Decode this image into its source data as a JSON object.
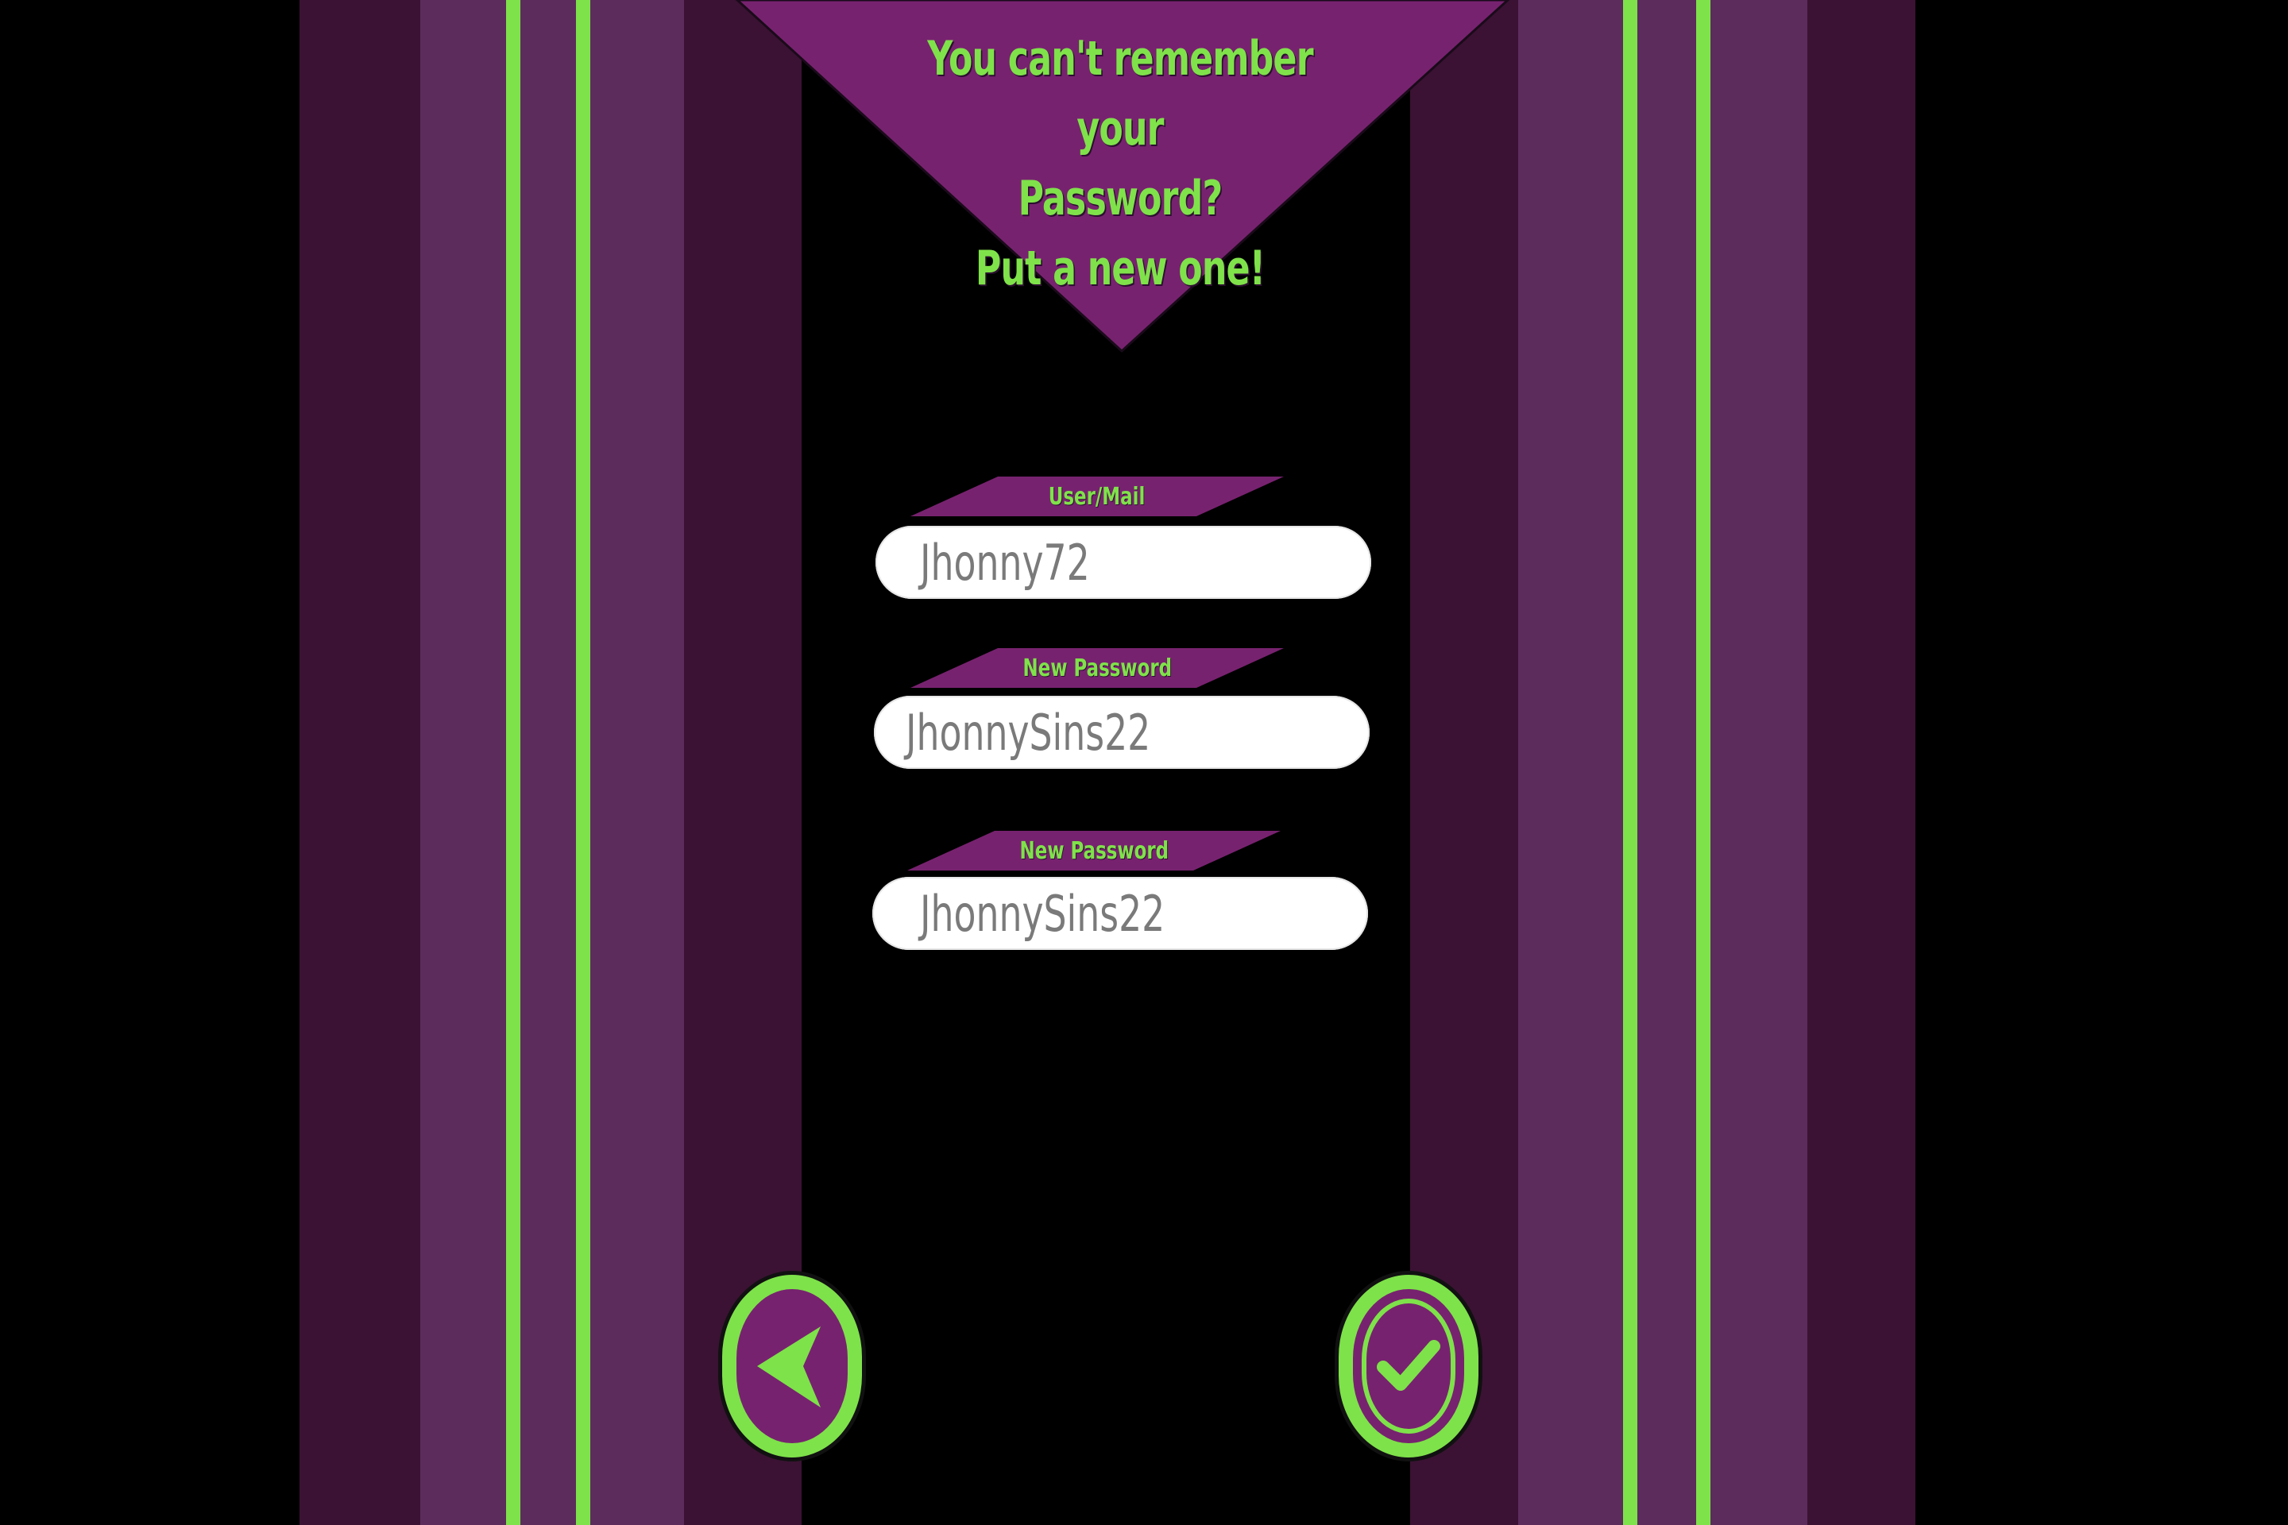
{
  "theme": {
    "accent_green": "#7ee24a",
    "purple_dark": "#3b1233",
    "purple_mid": "#5c2c5c",
    "purple_bright": "#77226f",
    "background": "#000000"
  },
  "header": {
    "line1": "You can't remember your",
    "line2": "Password?",
    "line3": "Put a new one!"
  },
  "form": {
    "user": {
      "label": "User/Mail",
      "value": "Jhonny72"
    },
    "new_password": {
      "label": "New Password",
      "value": "JhonnySins22"
    },
    "confirm_password": {
      "label": "New Password",
      "value": "JhonnySins22"
    }
  },
  "buttons": {
    "back_icon": "arrow-left-icon",
    "confirm_icon": "checkmark-icon"
  }
}
